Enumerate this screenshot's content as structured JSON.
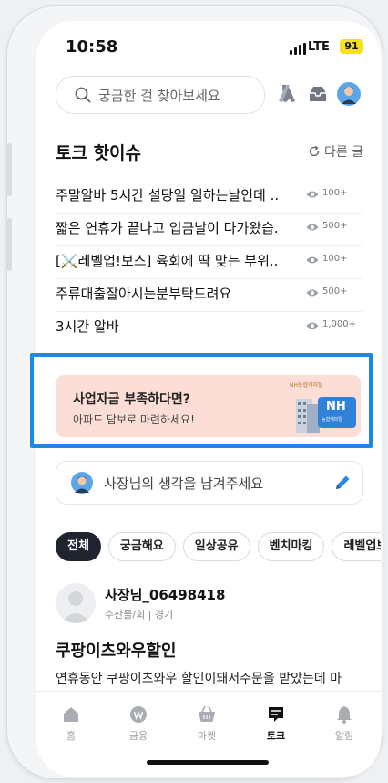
{
  "status_bar": {
    "time": "10:58",
    "network": "LTE",
    "battery": "91"
  },
  "search": {
    "placeholder": "궁금한 걸 찾아보세요"
  },
  "header_icons": [
    "ribbon-icon",
    "inbox-icon",
    "profile-avatar-icon"
  ],
  "hot_issues": {
    "title": "토크 핫이슈",
    "refresh_label": "다른 글",
    "items": [
      {
        "title": "주말알바 5시간 설당일 일하는날인데 ...",
        "views": "100+"
      },
      {
        "title": "짧은 연휴가 끝나고 입금날이 다가왔습...",
        "views": "500+"
      },
      {
        "title": "[⚔️레벨업!보스] 육회에 딱 맞는 부위...",
        "views": "100+"
      },
      {
        "title": "주류대출잘아시는분부탁드려요",
        "views": "500+"
      },
      {
        "title": "3시간 알바",
        "views": "1,000+"
      }
    ]
  },
  "ad": {
    "title": "사업자금 부족하다면?",
    "subtitle": "아파드 담보로 마련하세요!",
    "tag": "NH농협캐피탈",
    "badge": "NH",
    "badge_sub": "농협캐피탈"
  },
  "compose": {
    "placeholder": "사장님의 생각을 남겨주세요"
  },
  "filter_chips": [
    {
      "label": "전체",
      "active": true
    },
    {
      "label": "궁금해요",
      "active": false
    },
    {
      "label": "일상공유",
      "active": false
    },
    {
      "label": "벤치마킹",
      "active": false
    },
    {
      "label": "레벨업보스",
      "active": false
    }
  ],
  "post": {
    "username": "사장님_06498418",
    "meta": "수산물/회 | 경기",
    "title": "쿠팡이츠와우할인",
    "body": "연휴동안 쿠팡이츠와우 할인이돼서주문을 받았는데 마"
  },
  "tab_bar": {
    "items": [
      {
        "label": "홈",
        "icon": "home-icon",
        "active": false
      },
      {
        "label": "금융",
        "icon": "won-coin-icon",
        "active": false
      },
      {
        "label": "마켓",
        "icon": "basket-icon",
        "active": false
      },
      {
        "label": "토크",
        "icon": "chat-icon",
        "active": true
      },
      {
        "label": "알림",
        "icon": "bell-icon",
        "active": false
      }
    ]
  },
  "colors": {
    "accent": "#1e88e5",
    "ad_background": "#fcded6",
    "active_chip": "#1f2430",
    "battery": "#f5e21b"
  }
}
